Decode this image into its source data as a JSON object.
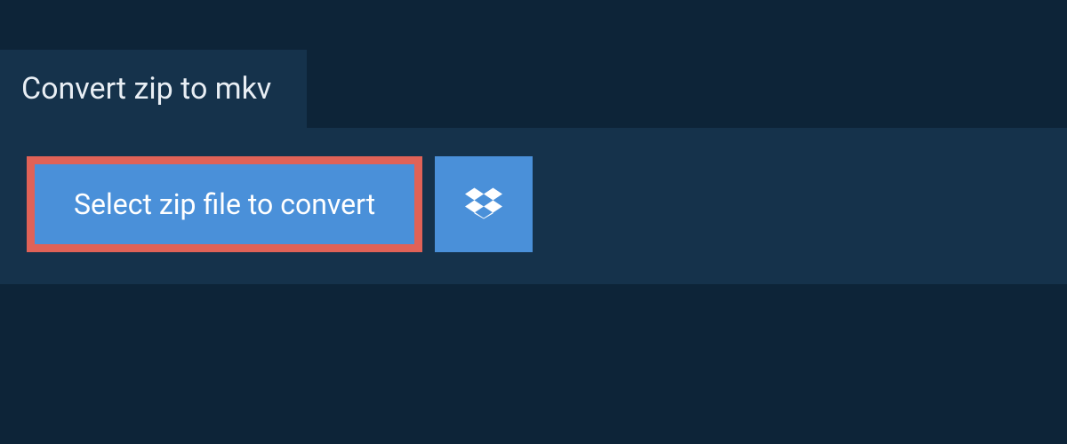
{
  "header": {
    "title": "Convert zip to mkv"
  },
  "actions": {
    "select_file_label": "Select zip file to convert",
    "dropbox_icon": "dropbox-icon"
  },
  "colors": {
    "background_dark": "#0d2438",
    "panel": "#15324b",
    "button_blue": "#4a90d9",
    "highlight_border": "#e06257",
    "text_light": "#e8eef4",
    "text_white": "#ffffff"
  }
}
